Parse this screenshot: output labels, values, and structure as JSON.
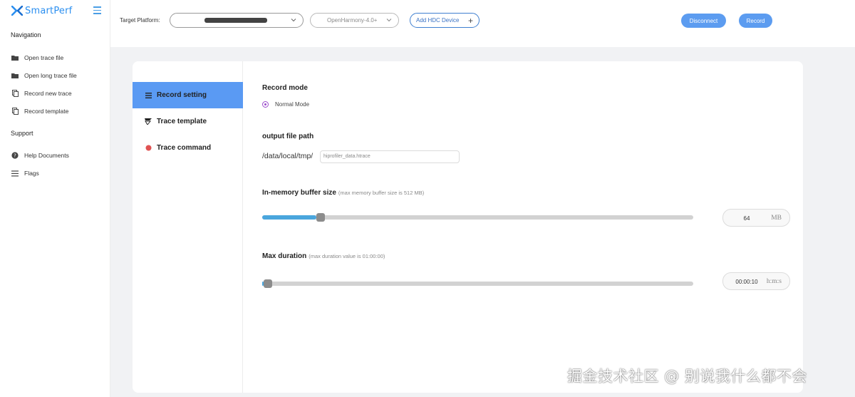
{
  "app": {
    "name": "SmartPerf"
  },
  "sidebar": {
    "nav_title": "Navigation",
    "nav_items": [
      {
        "label": "Open trace file",
        "icon": "folder-icon"
      },
      {
        "label": "Open long trace file",
        "icon": "folder-icon"
      },
      {
        "label": "Record new trace",
        "icon": "copy-icon"
      },
      {
        "label": "Record template",
        "icon": "copy-icon"
      }
    ],
    "support_title": "Support",
    "support_items": [
      {
        "label": "Help Documents",
        "icon": "help-icon"
      },
      {
        "label": "Flags",
        "icon": "menu-lines-icon"
      }
    ]
  },
  "topbar": {
    "platform_label": "Target Platform:",
    "os_version": "OpenHarmony-4.0+",
    "add_device_label": "Add HDC Device",
    "disconnect_label": "Disconnect",
    "record_label": "Record"
  },
  "tabs": [
    {
      "label": "Record setting",
      "icon": "list-icon",
      "active": true
    },
    {
      "label": "Trace template",
      "icon": "template-icon",
      "active": false
    },
    {
      "label": "Trace command",
      "icon": "red-dot-icon",
      "active": false
    }
  ],
  "record": {
    "mode_title": "Record mode",
    "mode_option": "Normal Mode",
    "path_title": "output file path",
    "path_prefix": "/data/local/tmp/",
    "path_placeholder": "hiprofiler_data.htrace",
    "buffer_title": "In-memory buffer size",
    "buffer_hint": "(max memory buffer size is 512 MB)",
    "buffer_value": "64",
    "buffer_unit": "MB",
    "buffer_fraction": 0.125,
    "duration_title": "Max duration",
    "duration_hint": "(max duration value is 01:00:00)",
    "duration_value": "00:00:10",
    "duration_unit": "h:m:s",
    "duration_fraction": 0.003
  },
  "colors": {
    "accent": "#5a9af3",
    "slider_fill": "#4aa6dd",
    "record_button": "#5c9cf0",
    "radio": "#9c4dcc",
    "command_dot": "#e05252"
  },
  "watermark": "掘金技术社区 @ 别说我什么都不会"
}
